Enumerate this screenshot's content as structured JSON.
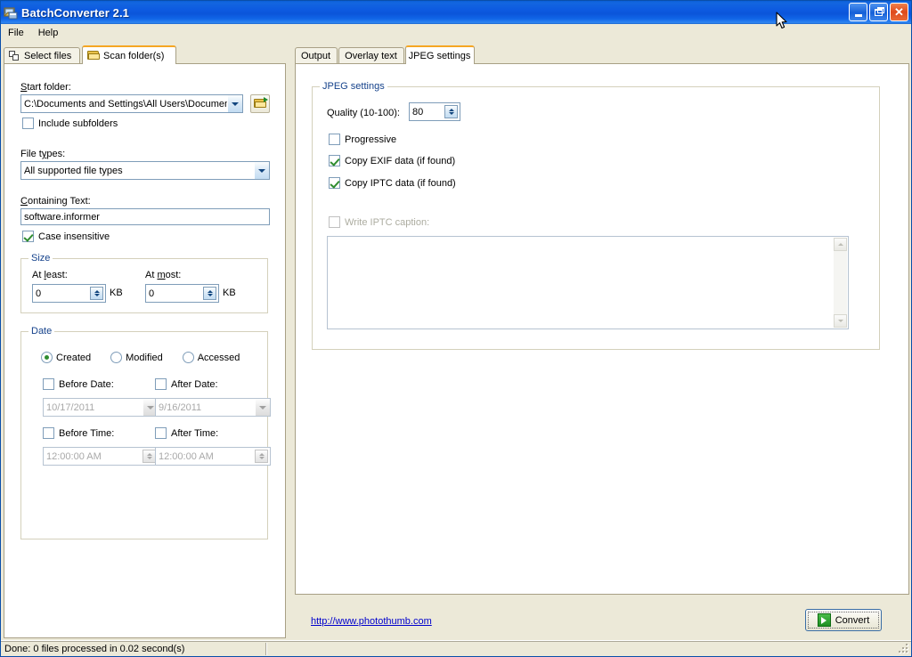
{
  "window": {
    "title": "BatchConverter 2.1",
    "icon": "app-window-icon",
    "minimize_label": "Minimize",
    "maximize_label": "Restore",
    "close_label": "Close"
  },
  "menu": {
    "items": [
      {
        "label": "File"
      },
      {
        "label": "Help"
      }
    ]
  },
  "left_panel": {
    "tabs": [
      {
        "label": "Select files",
        "icon": "documents-icon",
        "active": false
      },
      {
        "label": "Scan folder(s)",
        "icon": "folder-icon",
        "active": true
      }
    ],
    "start_folder": {
      "label": "Start folder:",
      "value": "C:\\Documents and Settings\\All Users\\Document",
      "browse_icon": "open-folder-icon"
    },
    "include_subfolders": {
      "label": "Include subfolders",
      "checked": false
    },
    "file_types": {
      "label": "File types:",
      "value": "All supported file types"
    },
    "containing_text": {
      "label": "Containing Text:",
      "value": "software.informer"
    },
    "case_insensitive": {
      "label": "Case insensitive",
      "checked": true
    },
    "size_group": {
      "title": "Size",
      "at_least_label": "At least:",
      "at_least_value": "0",
      "at_least_unit": "KB",
      "at_most_label": "At most:",
      "at_most_value": "0",
      "at_most_unit": "KB"
    },
    "date_group": {
      "title": "Date",
      "radios": [
        {
          "label": "Created",
          "checked": true
        },
        {
          "label": "Modified",
          "checked": false
        },
        {
          "label": "Accessed",
          "checked": false
        }
      ],
      "before_date": {
        "label": "Before Date:",
        "checked": false,
        "value": "10/17/2011"
      },
      "after_date": {
        "label": "After Date:",
        "checked": false,
        "value": "9/16/2011"
      },
      "before_time": {
        "label": "Before Time:",
        "checked": false,
        "value": "12:00:00 AM"
      },
      "after_time": {
        "label": "After Time:",
        "checked": false,
        "value": "12:00:00 AM"
      }
    }
  },
  "right_panel": {
    "tabs": [
      {
        "label": "Output",
        "active": false
      },
      {
        "label": "Overlay text",
        "active": false
      },
      {
        "label": "JPEG settings",
        "active": true
      }
    ],
    "jpeg_group": {
      "title": "JPEG settings",
      "quality_label": "Quality (10-100):",
      "quality_value": "80",
      "progressive": {
        "label": "Progressive",
        "checked": false
      },
      "copy_exif": {
        "label": "Copy EXIF data (if found)",
        "checked": true
      },
      "copy_iptc": {
        "label": "Copy IPTC data (if found)",
        "checked": true
      },
      "write_iptc_caption": {
        "label": "Write IPTC caption:",
        "checked": false,
        "disabled": true
      },
      "caption_value": ""
    }
  },
  "bottom": {
    "link_text": "http://www.photothumb.com",
    "convert_label": "Convert",
    "convert_icon": "play-green-icon"
  },
  "status": {
    "text": "Done: 0 files processed in 0.02 second(s)"
  },
  "colors": {
    "titlebar_blue": "#0b55da",
    "active_tab_accent": "#f5a623",
    "group_title": "#15428b",
    "link": "#0000cc",
    "face": "#ece9d8",
    "check_green": "#2f8c2f"
  }
}
